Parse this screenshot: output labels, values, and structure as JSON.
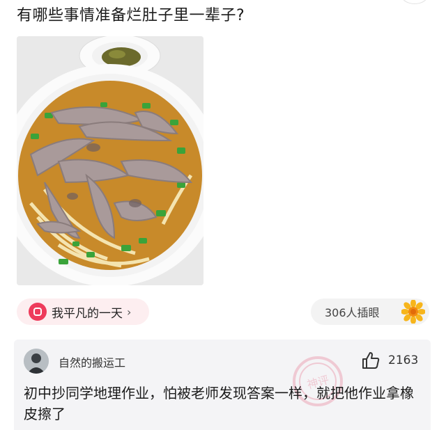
{
  "question": {
    "title": "有哪些事情准备烂肚子里一辈子?"
  },
  "post": {
    "image_alt": "一碗腰花面",
    "author_name": "我平凡的一天",
    "author_arrow": "›",
    "insert_count_label": "306人插眼",
    "insert_icon": "sunflower-icon"
  },
  "comment": {
    "username": "自然的搬运工",
    "like_icon": "thumbs-up-icon",
    "like_count": "2163",
    "text": "初中抄同学地理作业，怕被老师发现答案一样，就把他作业拿橡皮擦了",
    "watermark_text": "神评"
  },
  "colors": {
    "accent_pink": "#ee3b5b",
    "chip_bg": "#fdeef0",
    "card_bg": "#f4f4f6"
  }
}
